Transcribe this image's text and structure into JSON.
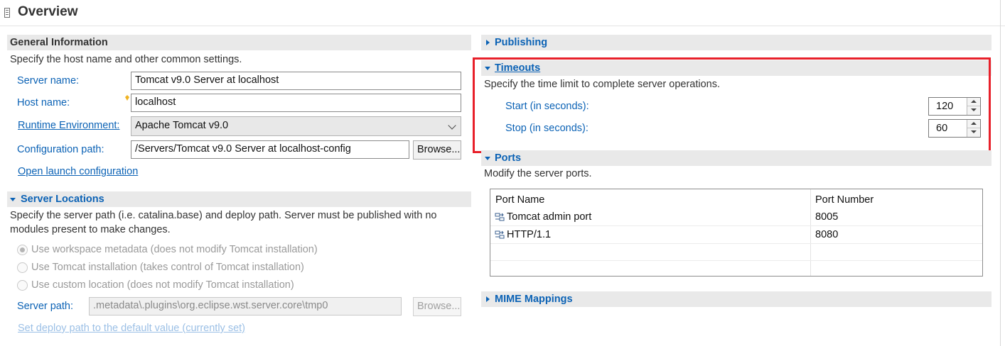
{
  "header": {
    "title": "Overview"
  },
  "general": {
    "title": "General Information",
    "description": "Specify the host name and other common settings.",
    "server_name_label": "Server name:",
    "server_name_value": "Tomcat v9.0 Server at localhost",
    "host_name_label": "Host name:",
    "host_name_value": "localhost",
    "runtime_label": "Runtime Environment:",
    "runtime_value": "Apache Tomcat v9.0",
    "config_path_label": "Configuration path:",
    "config_path_value": "/Servers/Tomcat v9.0 Server at localhost-config",
    "browse_label": "Browse...",
    "open_launch_label": "Open launch configuration"
  },
  "server_locations": {
    "title": "Server Locations",
    "description_line1": "Specify the server path (i.e. catalina.base) and deploy path. Server must be published with no",
    "description_line2": "modules present to make changes.",
    "options": [
      {
        "label": "Use workspace metadata (does not modify Tomcat installation)",
        "selected": true
      },
      {
        "label": "Use Tomcat installation (takes control of Tomcat installation)",
        "selected": false
      },
      {
        "label": "Use custom location (does not modify Tomcat installation)",
        "selected": false
      }
    ],
    "server_path_label": "Server path:",
    "server_path_value": ".metadata\\.plugins\\org.eclipse.wst.server.core\\tmp0",
    "browse_label": "Browse...",
    "deploy_link": "Set deploy path to the default value (currently set)"
  },
  "publishing": {
    "title": "Publishing"
  },
  "timeouts": {
    "title": "Timeouts",
    "description": "Specify the time limit to complete server operations.",
    "start_label": "Start (in seconds):",
    "start_value": "120",
    "stop_label": "Stop (in seconds):",
    "stop_value": "60",
    "highlight_color": "#e8202a"
  },
  "ports": {
    "title": "Ports",
    "description": "Modify the server ports.",
    "columns": [
      "Port Name",
      "Port Number"
    ],
    "rows": [
      {
        "name": "Tomcat admin port",
        "number": "8005"
      },
      {
        "name": "HTTP/1.1",
        "number": "8080"
      }
    ]
  },
  "mime": {
    "title": "MIME Mappings"
  },
  "colors": {
    "accent": "#0b62b5",
    "section_bg": "#e9e9e9"
  }
}
